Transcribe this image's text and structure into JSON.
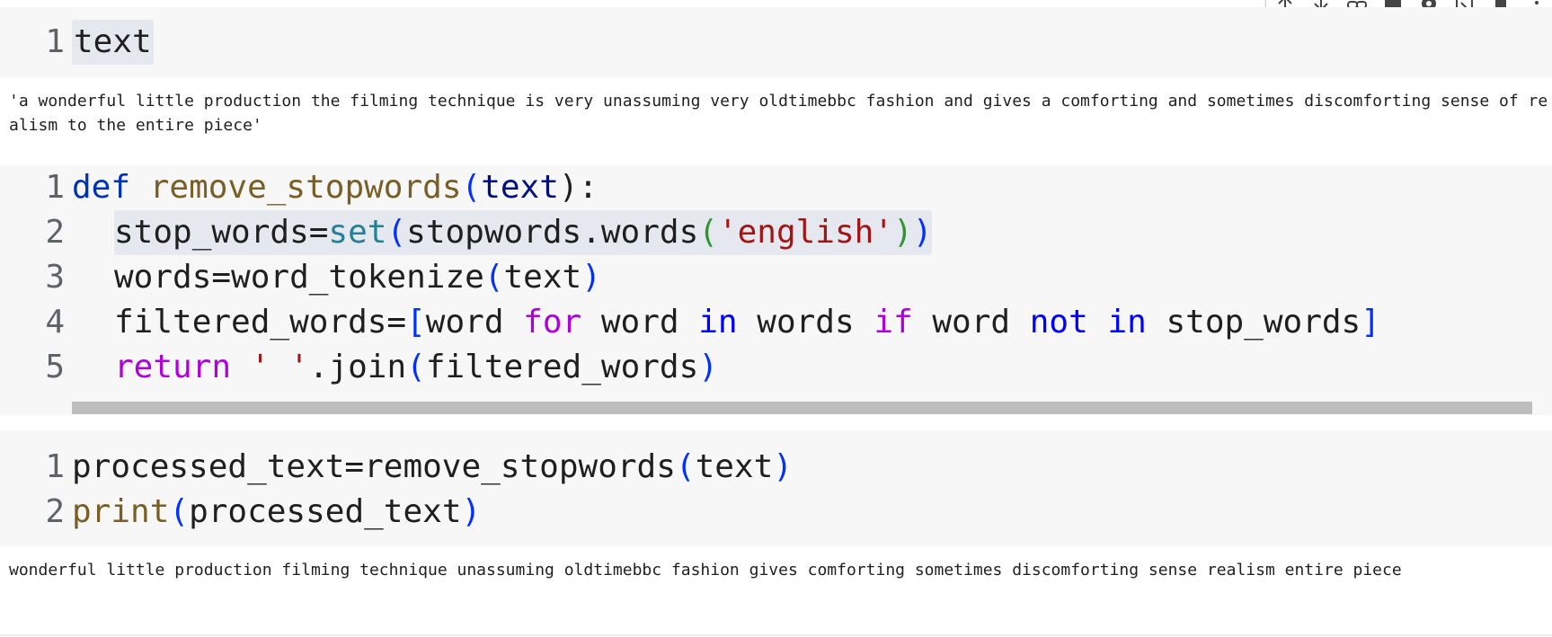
{
  "toolbar": {
    "icons": [
      "move-up-icon",
      "move-down-icon",
      "link-icon",
      "comment-icon",
      "settings-icon",
      "open-editor-icon",
      "delete-icon",
      "more-icon"
    ]
  },
  "cells": [
    {
      "lines": [
        {
          "num": "1",
          "text": "text"
        }
      ],
      "output": "'a wonderful little production the filming technique is very unassuming very oldtimebbc fashion and gives a comforting and sometimes discomforting sense of realism to the entire piece'"
    },
    {
      "lines": [
        {
          "num": "1"
        },
        {
          "num": "2"
        },
        {
          "num": "3"
        },
        {
          "num": "4"
        },
        {
          "num": "5"
        }
      ],
      "tokens": {
        "l1": [
          "def",
          " ",
          "remove_stopwords",
          "(",
          "text",
          "):"
        ],
        "l2": [
          "stop_words=",
          "set",
          "(",
          "stopwords.words",
          "(",
          "'english'",
          ")",
          ")"
        ],
        "l3": [
          "words=word_tokenize",
          "(",
          "text",
          ")"
        ],
        "l4": [
          "filtered_words=",
          "[",
          "word ",
          "for",
          " word ",
          "in",
          " words ",
          "if",
          " word ",
          "not",
          " ",
          "in",
          " stop_words",
          "]"
        ],
        "l5": [
          "return",
          " ",
          "' '",
          ".join",
          "(",
          "filtered_words",
          ")"
        ]
      }
    },
    {
      "lines": [
        {
          "num": "1"
        },
        {
          "num": "2"
        }
      ],
      "tokens": {
        "l1": [
          "processed_text=remove_stopwords",
          "(",
          "text",
          ")"
        ],
        "l2": [
          "print",
          "(",
          "processed_text",
          ")"
        ]
      },
      "output": "wonderful little production filming technique unassuming oldtimebbc fashion gives comforting sometimes discomforting sense realism entire piece"
    }
  ]
}
